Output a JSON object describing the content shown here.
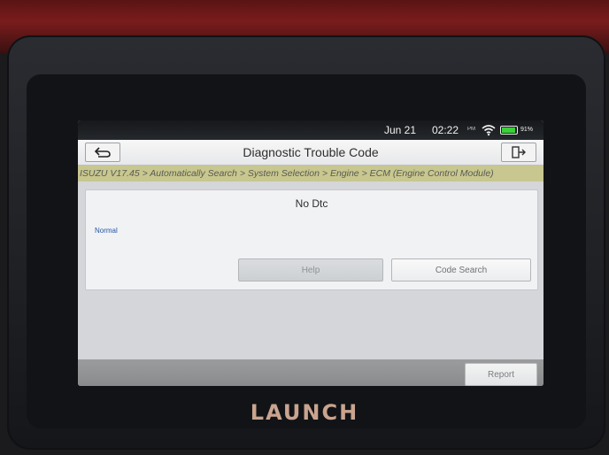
{
  "status_bar": {
    "date": "Jun 21",
    "time": "02:22",
    "notification": "PM",
    "battery": "91%",
    "battery_level": 0.91
  },
  "header": {
    "title": "Diagnostic Trouble Code",
    "back_icon": "back-arrow-icon",
    "exit_icon": "exit-icon"
  },
  "breadcrumb": "ISUZU V17.45 > Automatically Search > System Selection > Engine > ECM (Engine Control Module)",
  "dtc_panel": {
    "message": "No Dtc",
    "status": "Normal",
    "help_label": "Help",
    "code_search_label": "Code Search"
  },
  "footer": {
    "report_label": "Report"
  },
  "device": {
    "brand": "LAUNCH"
  },
  "colors": {
    "breadcrumb_bg": "#c7c78f",
    "status_text": "#2455a8"
  }
}
